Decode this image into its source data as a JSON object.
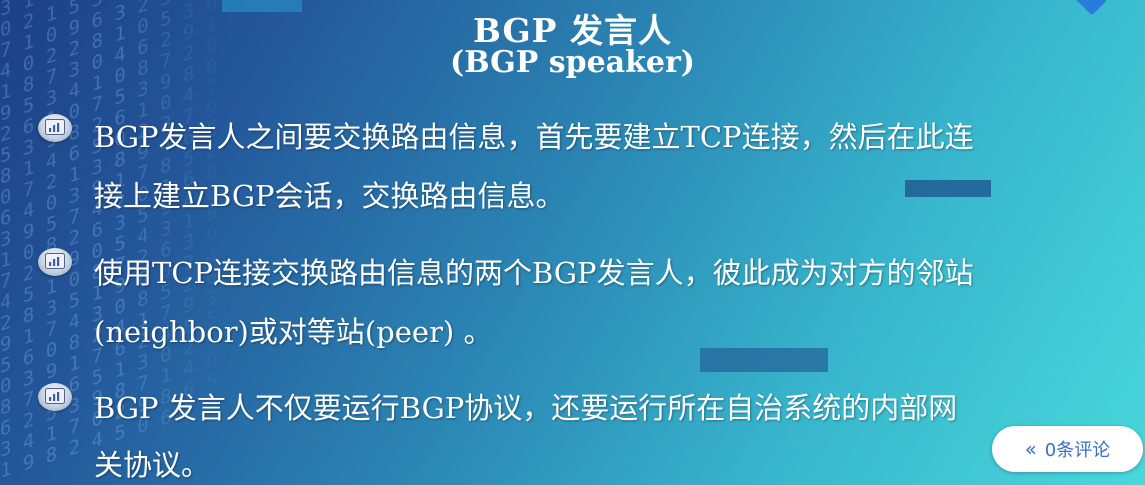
{
  "slide": {
    "title": "BGP 发言人",
    "subtitle": "(BGP speaker)",
    "bullets": [
      {
        "icon": "chart-bullet-icon",
        "lines": [
          "BGP发言人之间要交换路由信息，首先要建立TCP连接，然后在此连",
          "接上建立BGP会话，交换路由信息。"
        ]
      },
      {
        "icon": "chart-bullet-icon",
        "lines": [
          "使用TCP连接交换路由信息的两个BGP发言人，彼此成为对方的邻站",
          "(neighbor)或对等站(peer) 。"
        ]
      },
      {
        "icon": "chart-bullet-icon",
        "lines": [
          "BGP 发言人不仅要运行BGP协议，还要运行所在自治系统的内部网",
          "关协议。"
        ]
      }
    ]
  },
  "comments": {
    "icon": "double-chevron-left-icon",
    "label": "0条评论"
  },
  "colors": {
    "background_start": "#1d3f86",
    "background_end": "#48d8dc",
    "text": "#ffffff",
    "comment_accent": "#3a6fc8"
  }
}
